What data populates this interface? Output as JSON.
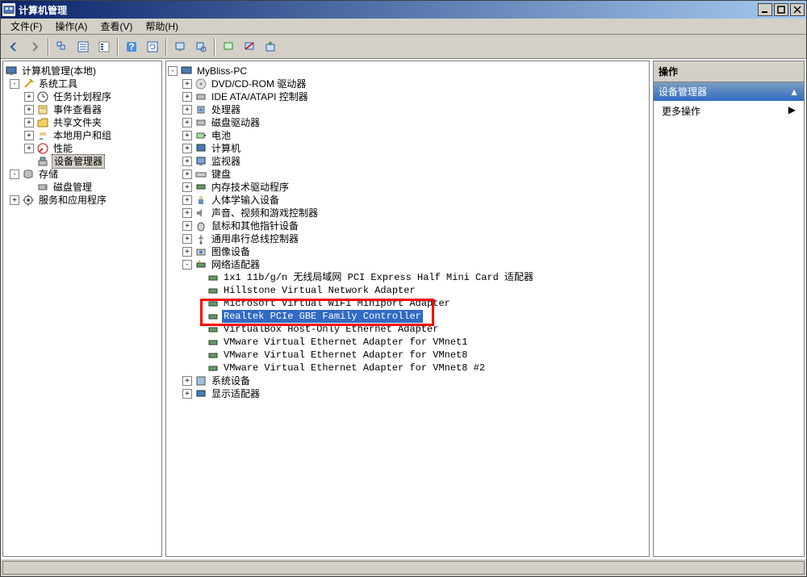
{
  "title": "计算机管理",
  "menu": {
    "file": "文件(F)",
    "action": "操作(A)",
    "view": "查看(V)",
    "help": "帮助(H)"
  },
  "leftTree": {
    "root": "计算机管理(本地)",
    "sysTools": "系统工具",
    "taskSched": "任务计划程序",
    "eventViewer": "事件查看器",
    "sharedFolders": "共享文件夹",
    "localUsers": "本地用户和组",
    "performance": "性能",
    "deviceMgr": "设备管理器",
    "storage": "存储",
    "diskMgmt": "磁盘管理",
    "servicesApps": "服务和应用程序"
  },
  "devTree": {
    "root": "MyBliss-PC",
    "dvd": "DVD/CD-ROM 驱动器",
    "ide": "IDE ATA/ATAPI 控制器",
    "cpu": "处理器",
    "disk": "磁盘驱动器",
    "battery": "电池",
    "computer": "计算机",
    "monitor": "监视器",
    "keyboard": "键盘",
    "memtech": "内存技术驱动程序",
    "hid": "人体学输入设备",
    "sound": "声音、视频和游戏控制器",
    "mouse": "鼠标和其他指针设备",
    "usb": "通用串行总线控制器",
    "imaging": "图像设备",
    "network": "网络适配器",
    "net1": "1x1 11b/g/n 无线局域网 PCI Express Half Mini Card 适配器",
    "net2": "Hillstone Virtual Network Adapter",
    "net3": "Microsoft Virtual WiFi Miniport Adapter",
    "net4": "Realtek PCIe GBE Family Controller",
    "net5": "VirtualBox Host-Only Ethernet Adapter",
    "net6": "VMware Virtual Ethernet Adapter for VMnet1",
    "net7": "VMware Virtual Ethernet Adapter for VMnet8",
    "net8": "VMware Virtual Ethernet Adapter for VMnet8 #2",
    "sysdev": "系统设备",
    "display": "显示适配器"
  },
  "rightPane": {
    "header": "操作",
    "section": "设备管理器",
    "moreActions": "更多操作"
  }
}
